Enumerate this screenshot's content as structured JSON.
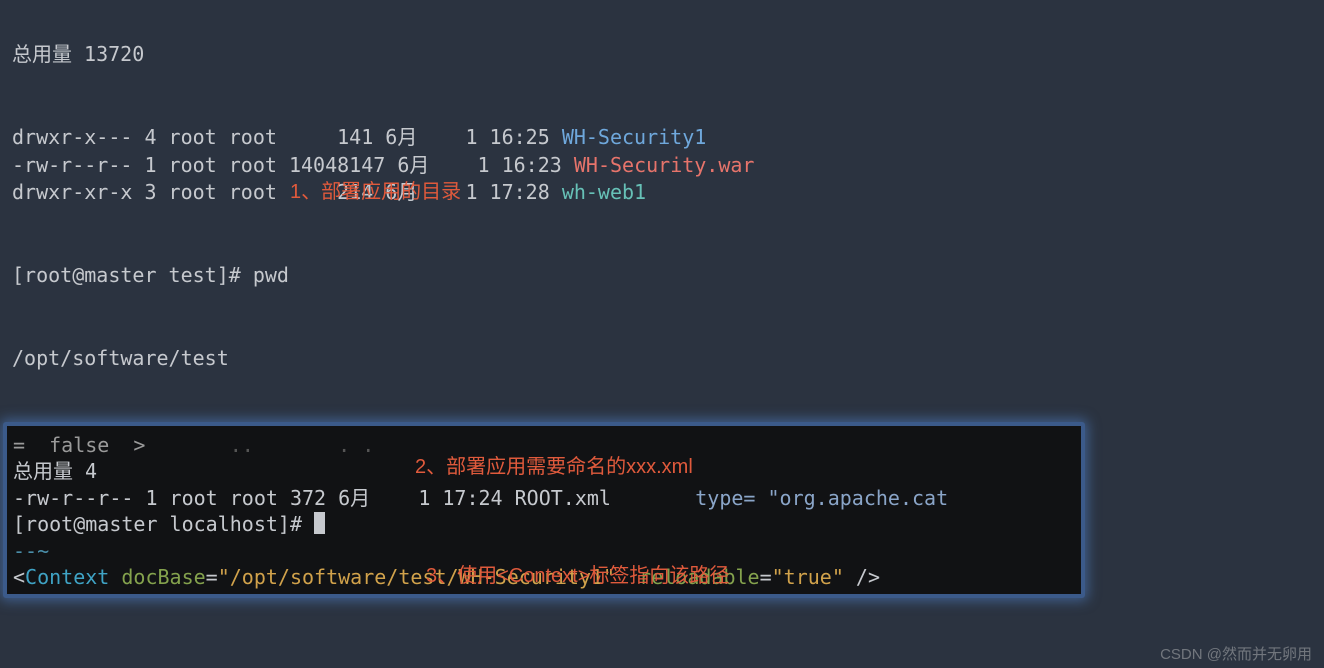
{
  "top": {
    "total_line": "总用量 13720",
    "rows": [
      {
        "perm": "drwxr-x---",
        "links": "4",
        "owner": "root",
        "group": "root",
        "size": "    141",
        "month": "6月",
        "day": "   1",
        "time": "16:25",
        "name": "WH-Security1",
        "cls": "dir"
      },
      {
        "perm": "-rw-r--r--",
        "links": "1",
        "owner": "root",
        "group": "root",
        "size": "14048147",
        "month": "6月",
        "day": "   1",
        "time": "16:23",
        "name": "WH-Security.war",
        "cls": "red"
      },
      {
        "perm": "drwxr-xr-x",
        "links": "3",
        "owner": "root",
        "group": "root",
        "size": "    214",
        "month": "6月",
        "day": "   1",
        "time": "17:28",
        "name": "wh-web1",
        "cls": "cyan"
      }
    ],
    "prompt1": "[root@master test]# pwd",
    "pwd_out": "/opt/software/test",
    "prompt2": "[root@master test]# ",
    "annotation1": "1、部署应用的目录"
  },
  "panel": {
    "frag_top": "=  false  >",
    "total": "总用量 4",
    "row": {
      "perm": "-rw-r--r--",
      "links": "1",
      "owner": "root",
      "group": "root",
      "size": "372",
      "month": "6月",
      "day": "   1",
      "time": "17:24",
      "name": "ROOT.xml"
    },
    "right_frag": "type= \"org.apache.cat",
    "prompt": "[root@master localhost]# ",
    "dashes": "--~",
    "annotation2": "2、部署应用需要命名的xxx.xml",
    "annotation3": "3、使用<Context>标签指向该路径",
    "context": {
      "lt": "<",
      "tag": "Context",
      "attr1_name": " docBase",
      "eq": "=",
      "attr1_val": "\"/opt/software/test/WH-Security1\"",
      "attr2_name": "  reloadable",
      "attr2_val": "\"true\"",
      "tail": " />"
    }
  },
  "watermark": "CSDN @然而并无卵用"
}
